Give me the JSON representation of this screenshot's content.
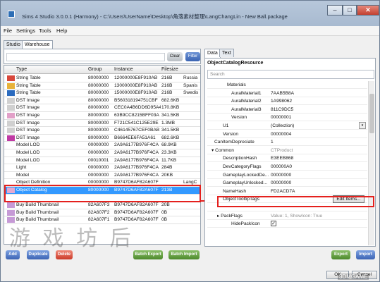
{
  "window": {
    "title": "Sims 4 Studio 3.0.0.1 (Harmony) - C:\\Users\\UserName\\Desktop\\角落素材整理\\LangChangLin - New Ball.package",
    "min": "–",
    "max": "□",
    "close": "✕"
  },
  "menu": [
    "File",
    "Settings",
    "Tools",
    "Help"
  ],
  "left_tabs": [
    "Studio",
    "Warehouse"
  ],
  "filter": {
    "clear": "Clear",
    "filter": "Filter"
  },
  "grid": {
    "columns": [
      "Type",
      "Group",
      "Instance",
      "Filesize",
      ""
    ],
    "rows": [
      {
        "type": "String Table",
        "group": "80000000",
        "instance": "12000000E8F910AB",
        "size": "216B",
        "name": "Russia",
        "thumb": "#d8473b"
      },
      {
        "type": "String Table",
        "group": "80000000",
        "instance": "13000000E8F910AB",
        "size": "216B",
        "name": "Spanis",
        "thumb": "#e8b23a"
      },
      {
        "type": "String Table",
        "group": "80000000",
        "instance": "15000000E8F910AB",
        "size": "216B",
        "name": "Swedis",
        "thumb": "#2b6bbf"
      },
      {
        "type": "DST Image",
        "group": "80000000",
        "instance": "B560318194751CBF",
        "size": "682.6KB",
        "name": "",
        "thumb": "#d0d0d0"
      },
      {
        "type": "DST Image",
        "group": "80000000",
        "instance": "CEC0A4B6DD6D95A4",
        "size": "170.8KB",
        "name": "",
        "thumb": "#d0d0d0"
      },
      {
        "type": "DST Image",
        "group": "80000000",
        "instance": "63B9CC8215BFF03A",
        "size": "341.5KB",
        "name": "",
        "thumb": "#e2a0c8"
      },
      {
        "type": "DST Image",
        "group": "80000000",
        "instance": "F721C541C125E29E",
        "size": "1.3MB",
        "name": "",
        "thumb": "#d0d0d0"
      },
      {
        "type": "DST Image",
        "group": "80000000",
        "instance": "C46145767CEF0BAB",
        "size": "341.5KB",
        "name": "",
        "thumb": "#d0d0d0"
      },
      {
        "type": "DST Image",
        "group": "80000000",
        "instance": "B6664EE6FA51A61",
        "size": "682.6KB",
        "name": "",
        "thumb": "#c03aa4"
      },
      {
        "type": "Model LOD",
        "group": "00000000",
        "instance": "2A9A6177B976F4CA",
        "size": "68.9KB",
        "name": "",
        "thumb": ""
      },
      {
        "type": "Model LOD",
        "group": "00000000",
        "instance": "2A9A6177B976F4CA",
        "size": "23.3KB",
        "name": "",
        "thumb": ""
      },
      {
        "type": "Model LOD",
        "group": "00010001",
        "instance": "2A9A6177B976F4CA",
        "size": "11.7KB",
        "name": "",
        "thumb": ""
      },
      {
        "type": "Light",
        "group": "00000000",
        "instance": "2A9A6177B976F4CA",
        "size": "284B",
        "name": "",
        "thumb": ""
      },
      {
        "type": "Model",
        "group": "00000000",
        "instance": "2A9A6177B976F4CA",
        "size": "20KB",
        "name": "",
        "thumb": ""
      },
      {
        "type": "Object Definition",
        "group": "00000000",
        "instance": "B9747D6AF82A607F",
        "size": "",
        "name": "LangC",
        "thumb": ""
      },
      {
        "type": "Object Catalog",
        "group": "80000000",
        "instance": "B9747D6AF82A607F",
        "size": "213B",
        "name": "",
        "thumb": "#e3a9d1"
      },
      {
        "type": "",
        "group": "",
        "instance": "",
        "size": "",
        "name": "",
        "thumb": ""
      },
      {
        "type": "Buy Build Thumbnail",
        "group": "82A607F3",
        "instance": "B9747D6AF82A607F",
        "size": "20B",
        "name": "",
        "thumb": "#c69ad6"
      },
      {
        "type": "Buy Build Thumbnail",
        "group": "82A607F2",
        "instance": "B9747D6AF82A607F",
        "size": "0B",
        "name": "",
        "thumb": "#c69ad6"
      },
      {
        "type": "Buy Build Thumbnail",
        "group": "82A607F1",
        "instance": "B9747D6AF82A607F",
        "size": "0B",
        "name": "",
        "thumb": "#c69ad6"
      }
    ]
  },
  "left_buttons": {
    "add": "Add",
    "duplicate": "Duplicate",
    "delete": "Delete",
    "batch_export": "Batch Export",
    "batch_import": "Batch Import"
  },
  "right_tabs": [
    "Data",
    "Text"
  ],
  "resource": {
    "title": "ObjectCatalogResource",
    "search_placeholder": "Search",
    "properties": [
      {
        "key": "Materials",
        "value": "",
        "indent": 28,
        "gray": true
      },
      {
        "key": "AuralMaterial1",
        "value": "7AAB5B8A",
        "indent": 34,
        "gray": false
      },
      {
        "key": "AuralMaterial2",
        "value": "1A998062",
        "indent": 34,
        "gray": false
      },
      {
        "key": "AuralMaterial3",
        "value": "811C9DC5",
        "indent": 34,
        "gray": false
      },
      {
        "key": "Version",
        "value": "00000001",
        "indent": 34,
        "gray": false
      },
      {
        "key": "U1",
        "value": "(Collection)",
        "indent": 22,
        "gray": false
      },
      {
        "key": "Version",
        "value": "00000004",
        "indent": 22,
        "gray": false
      },
      {
        "key": "CanItemDepreciate",
        "value": "1",
        "indent": 10,
        "gray": false
      },
      {
        "key": "▾ Common",
        "value": "CTProduct",
        "indent": 6,
        "gray": true
      },
      {
        "key": "DescriptionHash",
        "value": "E3EEB868",
        "indent": 22,
        "gray": false
      },
      {
        "key": "DevCategoryFlags",
        "value": "000000A0",
        "indent": 22,
        "gray": false
      },
      {
        "key": "GameplayLockedDe...",
        "value": "00000000",
        "indent": 22,
        "gray": false
      },
      {
        "key": "GameplayUnlocked...",
        "value": "00000000",
        "indent": 22,
        "gray": false
      },
      {
        "key": "NameHash",
        "value": "FD2ACD7A",
        "indent": 22,
        "gray": false
      },
      {
        "key": "ObjectTooltipTags",
        "value": "",
        "indent": 22,
        "gray": false
      },
      {
        "key": "",
        "value": "",
        "indent": 0,
        "gray": false
      },
      {
        "key": "▸ PackFlags",
        "value": "Value: 1, ShowIcon: True",
        "indent": 14,
        "gray": true
      },
      {
        "key": "HidePackIcon",
        "value": "",
        "indent": 34,
        "gray": false
      }
    ],
    "edit_items": "Edit Items..."
  },
  "right_buttons": {
    "export": "Export",
    "import": "Import"
  },
  "footer_buttons": {
    "ok": "OK",
    "cancel": "Cancel"
  },
  "watermark": "游 戏 坊 后",
  "watermark_logo": "3DMGAME"
}
